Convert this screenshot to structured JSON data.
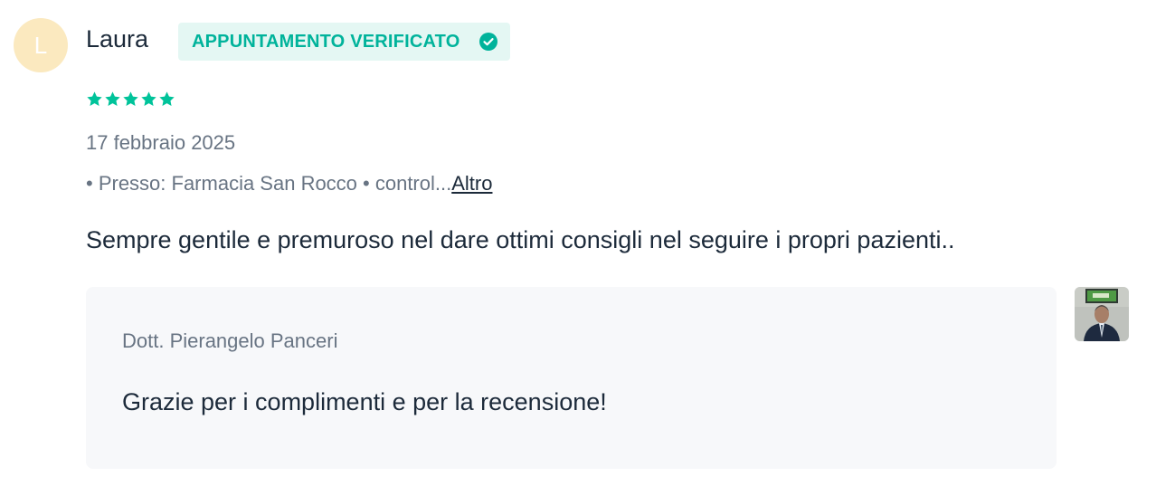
{
  "review": {
    "avatar_initial": "L",
    "author": "Laura",
    "badge": {
      "label": "APPUNTAMENTO VERIFICATO",
      "icon": "check-circle-icon",
      "color": "#00b39b",
      "background": "#e4f7f3"
    },
    "rating": {
      "value": 5,
      "max": 5,
      "color": "#00c39a"
    },
    "date": "17 febbraio 2025",
    "meta": {
      "prefix": "• Presso: Farmacia San Rocco • control...",
      "more_label": "Altro"
    },
    "comment": "Sempre gentile e premuroso nel dare ottimi consigli nel seguire i propri pazienti.."
  },
  "reply": {
    "author": "Dott. Pierangelo Panceri",
    "text": "Grazie per i complimenti e per la recensione!",
    "photo_icon": "doctor-photo"
  }
}
